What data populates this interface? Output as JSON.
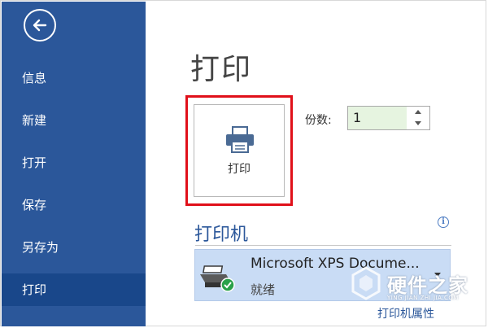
{
  "sidebar": {
    "back_label": "",
    "items": [
      {
        "label": "信息"
      },
      {
        "label": "新建"
      },
      {
        "label": "打开"
      },
      {
        "label": "保存"
      },
      {
        "label": "另存为"
      },
      {
        "label": "打印",
        "active": true
      }
    ],
    "bg_color": "#2b579a",
    "active_color": "#19478a"
  },
  "main": {
    "title": "打印",
    "print_button_label": "打印",
    "copies_label": "份数:",
    "copies_value": "1",
    "printer_section_title": "打印机",
    "printer": {
      "name": "Microsoft XPS Docume...",
      "status": "就绪"
    },
    "printer_properties_link": "打印机属性"
  },
  "watermark": {
    "text": "硬件之家",
    "subtext": "YING JIAN ZHI JIA.COM"
  },
  "colors": {
    "accent": "#2b579a",
    "highlight_border": "#e0101a",
    "copies_bg": "#e6f4e0",
    "printer_select_bg": "#c9dcf5"
  }
}
